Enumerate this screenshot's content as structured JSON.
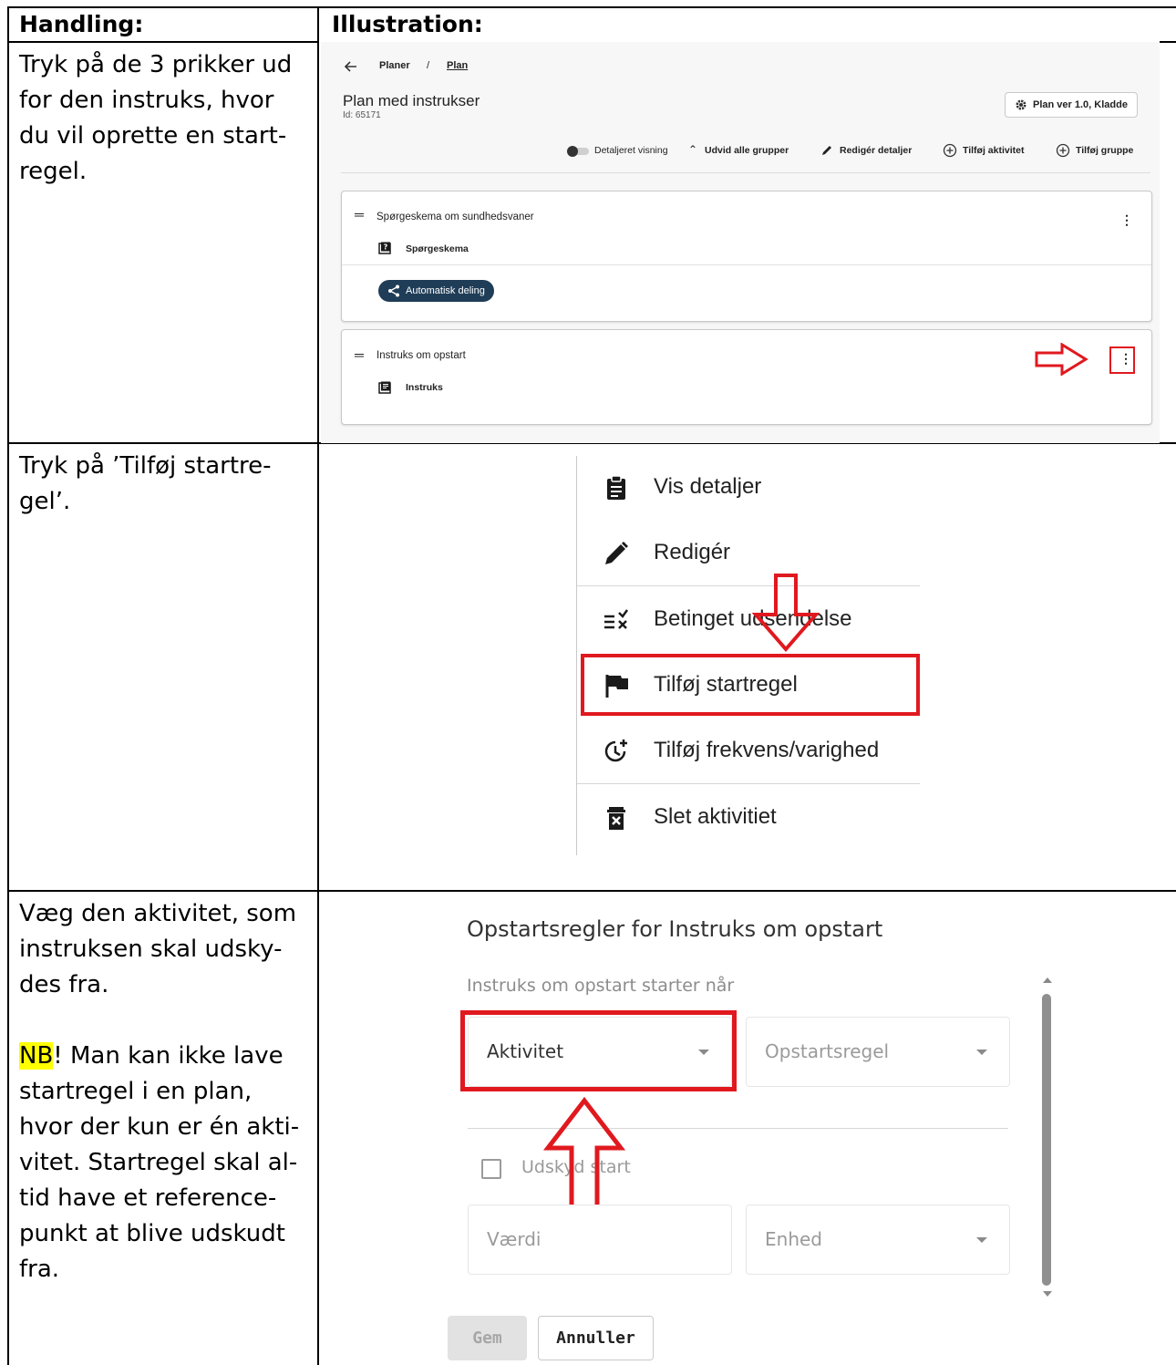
{
  "table": {
    "header": {
      "col1": "Handling:",
      "col2": "Illustration:"
    },
    "rows": [
      {
        "instruction": "Tryk på de 3 prikker ud for den instruks, hvor du vil oprette en start-regel."
      },
      {
        "instruction": "Tryk på ’Tilføj startre-gel’."
      },
      {
        "instruction": "Væg den aktivitet, som instruksen skal udsky-des fra.",
        "note_highlight": "NB",
        "note_rest": "! Man kan ikke lave startregel i en plan, hvor der kun er én akti-vitet. Startregel skal al-tid have et reference-punkt at blive udskudt fra."
      }
    ]
  },
  "screenshot1": {
    "breadcrumb": {
      "parent": "Planer",
      "separator": "/",
      "current": "Plan"
    },
    "title": "Plan med instrukser",
    "id_text": "Id: 65171",
    "version_button": "Plan ver 1.0, Kladde",
    "toolbar": {
      "detail_toggle": "Detaljeret visning",
      "expand": "Udvid alle grupper",
      "edit": "Redigér detaljer",
      "add_activity": "Tilføj aktivitet",
      "add_group": "Tilføj gruppe"
    },
    "card1": {
      "title": "Spørgeskema om sundhedsvaner",
      "item": "Spørgeskema",
      "chip": "Automatisk deling"
    },
    "card2": {
      "title": "Instruks om opstart",
      "item": "Instruks"
    }
  },
  "menu": {
    "items": [
      {
        "label": "Vis detaljer",
        "icon": "clipboard-icon"
      },
      {
        "label": "Redigér",
        "icon": "pencil-icon"
      },
      {
        "label": "Betinget udsendelse",
        "icon": "checklist-x-icon"
      },
      {
        "label": "Tilføj startregel",
        "icon": "flag-icon"
      },
      {
        "label": "Tilføj frekvens/varighed",
        "icon": "clock-plus-icon"
      },
      {
        "label": "Slet aktivitiet",
        "icon": "trash-icon"
      }
    ]
  },
  "dialog": {
    "title": "Opstartsregler for Instruks om opstart",
    "subtitle": "Instruks om opstart starter når",
    "activity_select": "Aktivitet",
    "rule_select": "Opstartsregel",
    "postpone_checkbox": "Udskyd start",
    "value_field": "Værdi",
    "unit_select": "Enhed",
    "save_button": "Gem",
    "cancel_button": "Annuller"
  },
  "colors": {
    "annotation_red": "#e0191f",
    "chip_navy": "#1f3d57",
    "highlight": "#ffff00"
  }
}
